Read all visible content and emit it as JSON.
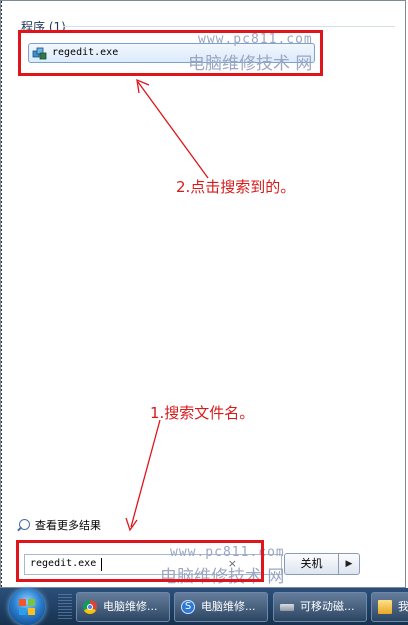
{
  "start_menu": {
    "section_title": "程序 (1)",
    "result_label": "regedit.exe",
    "see_more": "查看更多结果",
    "search_value": "regedit.exe",
    "clear_glyph": "×",
    "shutdown_label": "关机",
    "shutdown_arrow": "▶"
  },
  "annotations": {
    "step2": "2.点击搜索到的。",
    "step1": "1.搜索文件名。"
  },
  "watermark": {
    "url": "www.pc811.com",
    "text": "电脑维修技术 网",
    "text_bottom": "电脑维修技术 网"
  },
  "taskbar": {
    "buttons": [
      {
        "label": "电脑维修...",
        "icon": "chrome-icon"
      },
      {
        "label": "电脑维修...",
        "icon": "sogou-browser-icon"
      },
      {
        "label": "可移动磁...",
        "icon": "removable-drive-icon"
      },
      {
        "label": "我",
        "icon": "folder-icon"
      }
    ]
  },
  "colors": {
    "annotation_red": "#e0141b",
    "taskbar": "#1f3d62",
    "highlight": "#dcebfc"
  }
}
